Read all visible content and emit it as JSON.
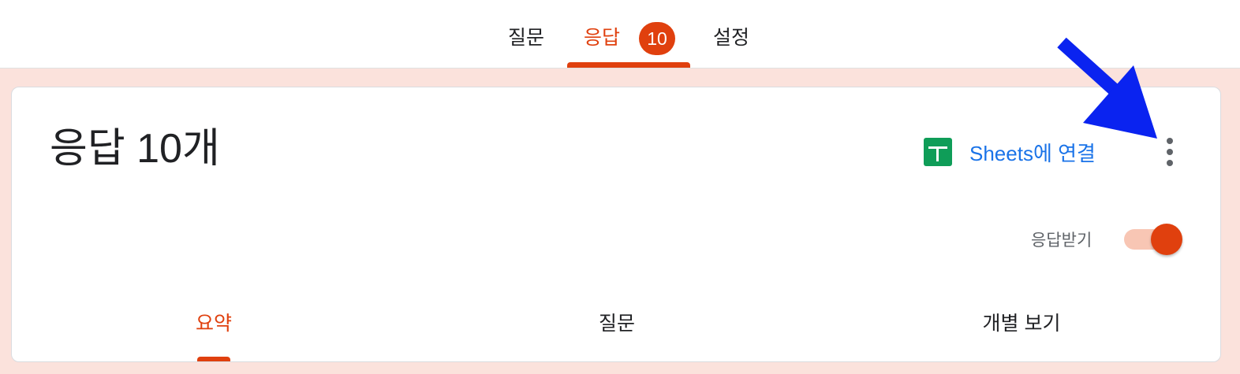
{
  "top_tabs": [
    {
      "label": "질문",
      "active": false
    },
    {
      "label": "응답",
      "active": true,
      "badge": "10"
    },
    {
      "label": "설정",
      "active": false
    }
  ],
  "card": {
    "title": "응답 10개",
    "sheets_button": {
      "label": "Sheets에 연결",
      "icon": "google-sheets-icon"
    },
    "more_icon": "more-vert-icon",
    "accepting": {
      "label": "응답받기",
      "on": true
    }
  },
  "sub_tabs": [
    {
      "label": "요약",
      "active": true
    },
    {
      "label": "질문",
      "active": false
    },
    {
      "label": "개별 보기",
      "active": false
    }
  ],
  "colors": {
    "accent": "#e0400e",
    "link": "#1a73e8",
    "sheets_green": "#0f9d58",
    "page_bg": "#fbe2dc",
    "annotation_arrow": "#0a23f0"
  }
}
